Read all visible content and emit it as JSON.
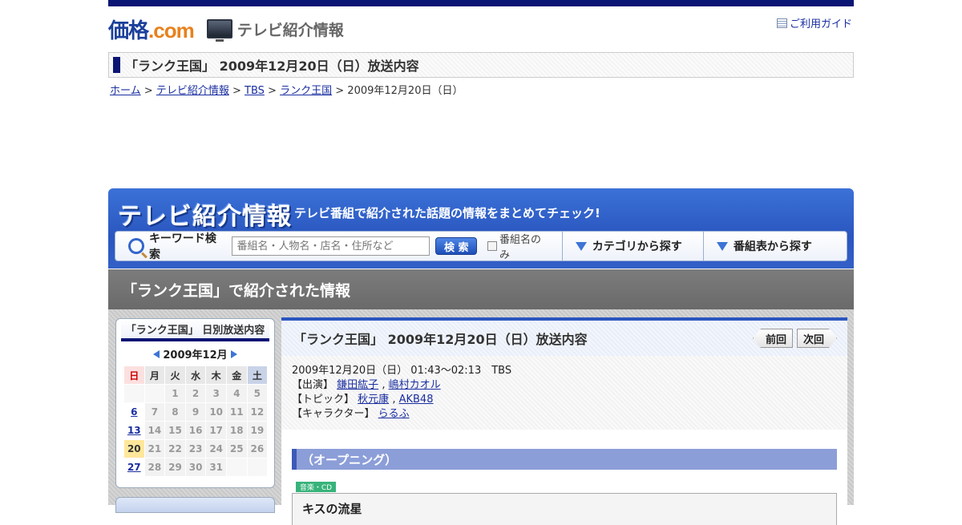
{
  "header": {
    "logo_main": "価格",
    "logo_dot": ".com",
    "logo_sub": "テレビ紹介情報",
    "guide_link": "ご利用ガイド"
  },
  "page_title": "「ランク王国」 2009年12月20日（日）放送内容",
  "breadcrumb": {
    "home": "ホーム",
    "sep": ">",
    "tv_info": "テレビ紹介情報",
    "station": "TBS",
    "program": "ランク王国",
    "current": "2009年12月20日（日）"
  },
  "banner": {
    "title": "テレビ紹介情報",
    "subtitle": "テレビ番組で紹介された話題の情報をまとめてチェック!",
    "keyword_label": "キーワード検索",
    "keyword_placeholder": "番組名・人物名・店名・住所など",
    "search_button": "検 索",
    "program_only": "番組名のみ",
    "category_tab": "カテゴリから探す",
    "schedule_tab": "番組表から探す"
  },
  "section_title": "「ランク王国」で紹介された情報",
  "sidebar": {
    "heading": "「ランク王国」 日別放送内容",
    "month": "2009年12月",
    "weekdays": [
      "日",
      "月",
      "火",
      "水",
      "木",
      "金",
      "土"
    ],
    "weeks": [
      [
        "",
        "",
        "1",
        "2",
        "3",
        "4",
        "5"
      ],
      [
        "6",
        "7",
        "8",
        "9",
        "10",
        "11",
        "12"
      ],
      [
        "13",
        "14",
        "15",
        "16",
        "17",
        "18",
        "19"
      ],
      [
        "20",
        "21",
        "22",
        "23",
        "24",
        "25",
        "26"
      ],
      [
        "27",
        "28",
        "29",
        "30",
        "31",
        "",
        ""
      ]
    ]
  },
  "main": {
    "title": "「ランク王国」 2009年12月20日（日）放送内容",
    "prev_button": "前回",
    "next_button": "次回",
    "broadcast": "2009年12月20日（日） 01:43～02:13　TBS",
    "cast_label": "【出演】",
    "cast": [
      "鎌田紘子",
      "嶋村カオル"
    ],
    "topic_label": "【トピック】",
    "topics": [
      "秋元康",
      "AKB48"
    ],
    "character_label": "【キャラクター】",
    "character": "らるふ",
    "comma": ",",
    "segment_title": "（オープニング）",
    "category_badge": "音楽・CD",
    "item_title": "キスの流星"
  },
  "colors": {
    "navy": "#0b1574",
    "blue": "#2a56bf",
    "link": "#1a2ea0",
    "band_gray": "#737373"
  }
}
